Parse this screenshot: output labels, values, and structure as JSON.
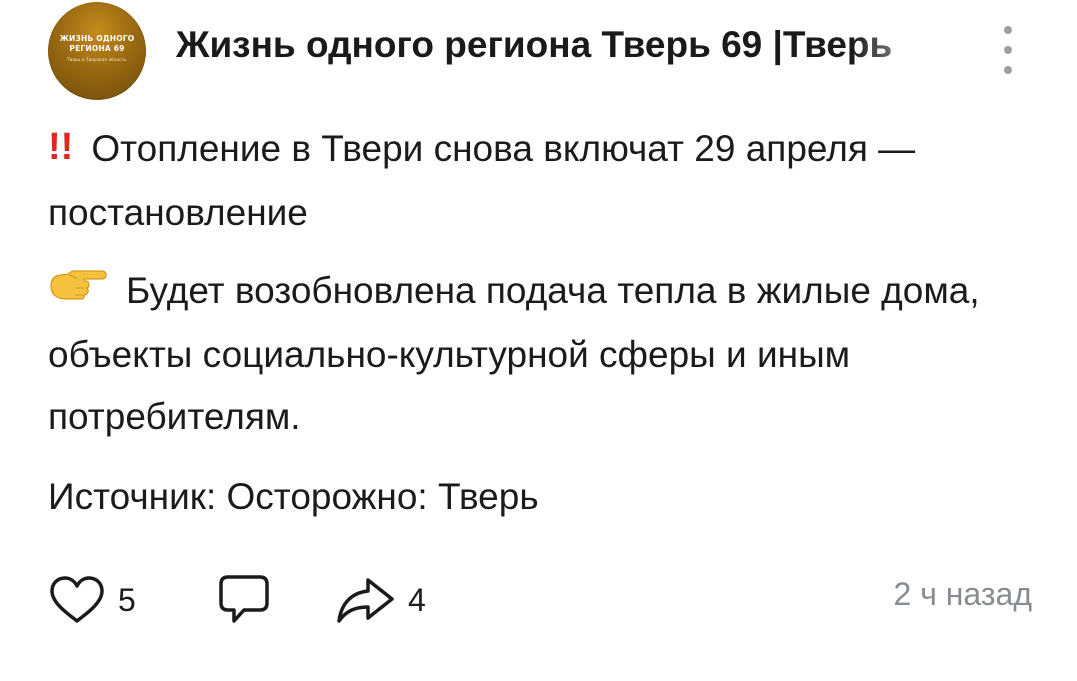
{
  "header": {
    "channel_title": "Жизнь одного региона Тверь 69 |Тверь",
    "avatar_lines": [
      "ЖИЗНЬ ОДНОГО",
      "РЕГИОНА 69",
      "Тверь и Тверская область"
    ]
  },
  "post": {
    "headline_icon": "double-exclamation-icon",
    "headline": "Отопление в Твери снова включат 29 апреля — постановление",
    "body_icon": "pointing-right-hand-icon",
    "body": "Будет возобновлена подача тепла в жилые дома, объекты социально-культурной сферы и иным потребителям.",
    "source": "Источник: Осторожно: Тверь"
  },
  "footer": {
    "likes": "5",
    "reposts": "4",
    "timestamp": "2 ч назад"
  },
  "colors": {
    "exclamation": "#e0261f",
    "text": "#1b1b1b",
    "muted": "#878c93",
    "avatar": "#9a6a12"
  }
}
